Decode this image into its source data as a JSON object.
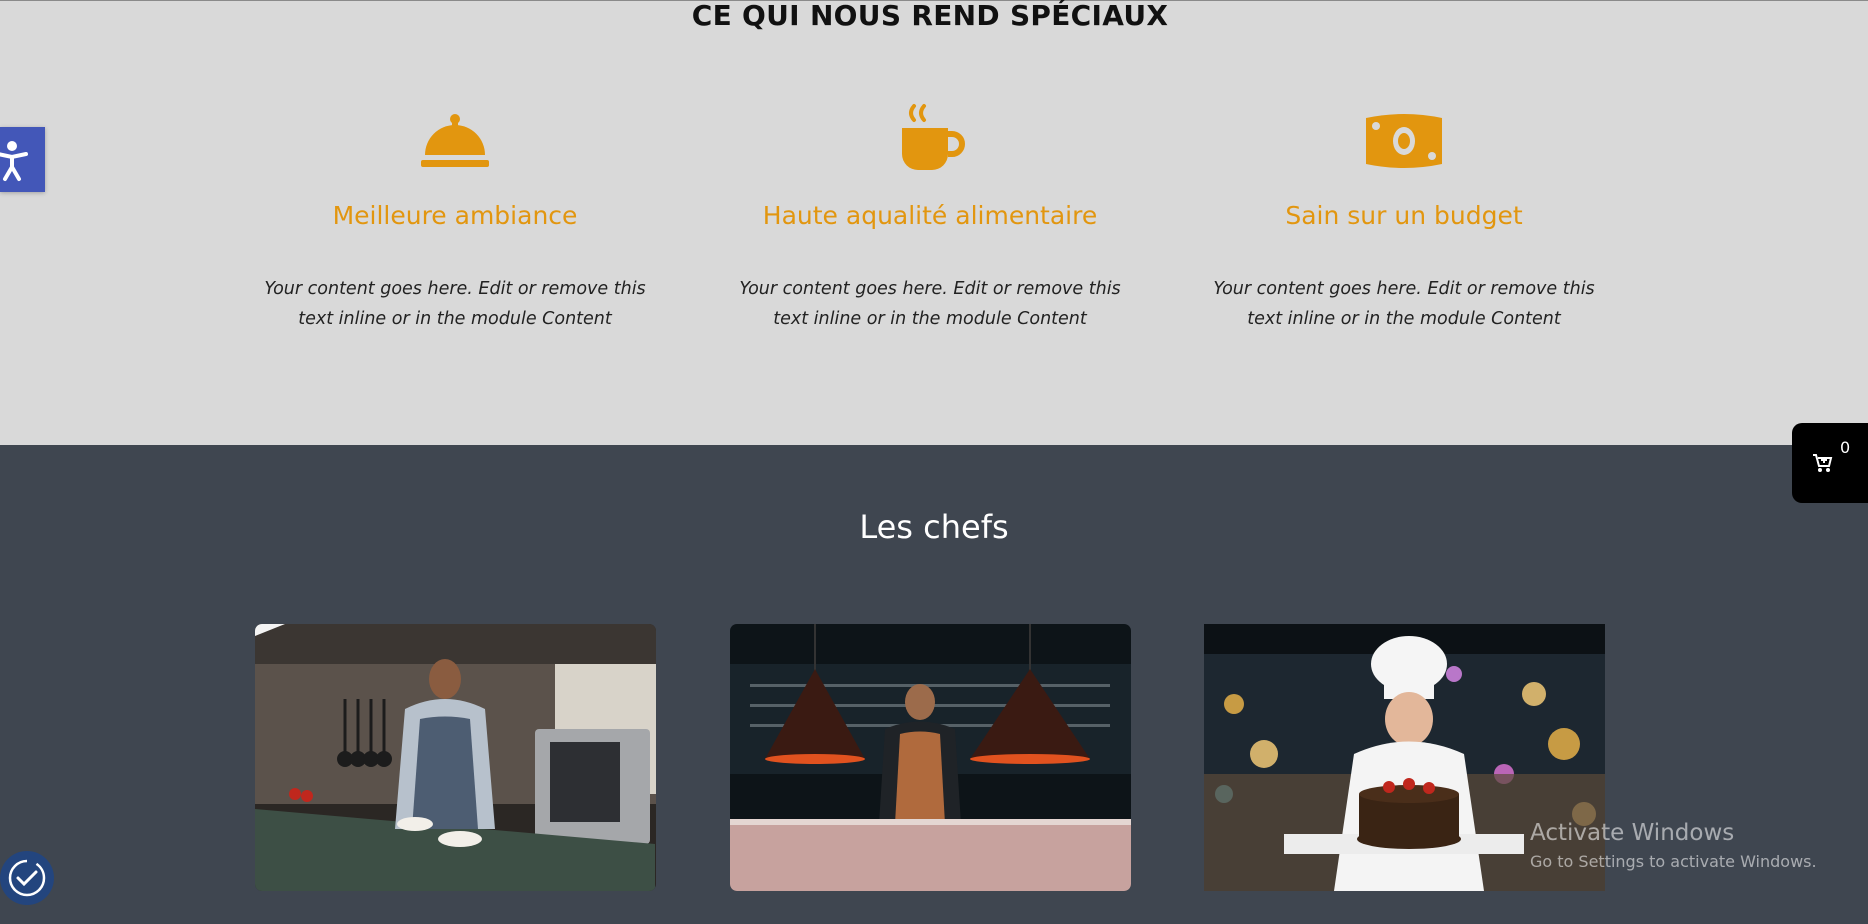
{
  "features_section": {
    "title": "CE QUI NOUS REND SPÉCIAUX",
    "items": [
      {
        "icon": "service-bell-icon",
        "heading": "Meilleure ambiance",
        "body": "Your content goes here. Edit or remove this text inline or in the module Content"
      },
      {
        "icon": "coffee-cup-icon",
        "heading": "Haute aqualité alimentaire",
        "body": "Your content goes here. Edit or remove this text inline or in the module Content"
      },
      {
        "icon": "money-bill-icon",
        "heading": "Sain sur un budget",
        "body": "Your content goes here. Edit or remove this text inline or in the module Content"
      }
    ],
    "accent_color": "#e2960f",
    "background_color": "#d9d9d9"
  },
  "chefs_section": {
    "title": "Les chefs",
    "background_color": "#3f4650",
    "images": [
      "chef-photo-kitchen",
      "chef-photo-heat-lamps",
      "chef-photo-cake"
    ]
  },
  "accessibility": {
    "icon": "accessibility-person-icon",
    "color": "#4357b8"
  },
  "cart": {
    "icon": "shopping-cart-icon",
    "count": "0"
  },
  "cookie": {
    "icon": "cookie-settings-icon"
  },
  "watermark": {
    "title": "Activate Windows",
    "subtitle": "Go to Settings to activate Windows."
  }
}
